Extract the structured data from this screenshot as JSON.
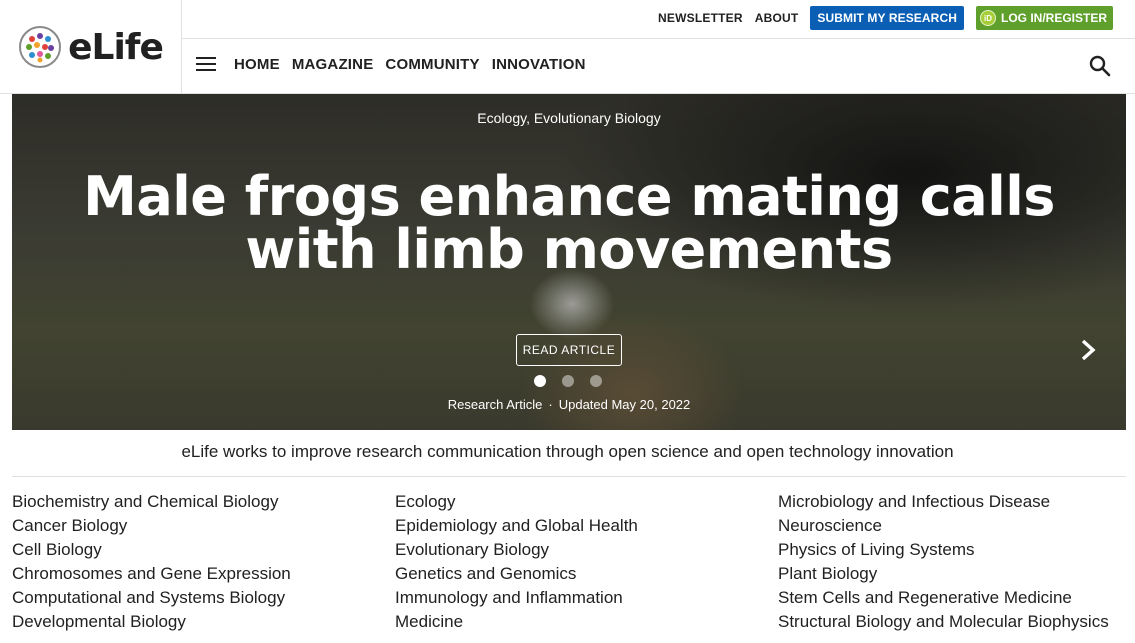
{
  "brand": {
    "name": "eLife"
  },
  "top_links": {
    "newsletter": "NEWSLETTER",
    "about": "ABOUT",
    "submit": "SUBMIT MY RESEARCH",
    "login": "LOG IN/REGISTER",
    "orcid_badge": "iD"
  },
  "nav": {
    "items": [
      {
        "label": "HOME"
      },
      {
        "label": "MAGAZINE"
      },
      {
        "label": "COMMUNITY"
      },
      {
        "label": "INNOVATION"
      }
    ]
  },
  "hero": {
    "subjects": "Ecology, Evolutionary Biology",
    "title": "Male frogs enhance mating calls with limb movements",
    "cta": "READ ARTICLE",
    "article_type": "Research Article",
    "separator": "·",
    "updated": "Updated May 20, 2022",
    "slides_total": 3,
    "active_slide": 1
  },
  "tagline": "eLife works to improve research communication through open science and open technology innovation",
  "subjects": {
    "col1": [
      "Biochemistry and Chemical Biology",
      "Cancer Biology",
      "Cell Biology",
      "Chromosomes and Gene Expression",
      "Computational and Systems Biology",
      "Developmental Biology"
    ],
    "col2": [
      "Ecology",
      "Epidemiology and Global Health",
      "Evolutionary Biology",
      "Genetics and Genomics",
      "Immunology and Inflammation",
      "Medicine"
    ],
    "col3": [
      "Microbiology and Infectious Disease",
      "Neuroscience",
      "Physics of Living Systems",
      "Plant Biology",
      "Stem Cells and Regenerative Medicine",
      "Structural Biology and Molecular Biophysics"
    ]
  },
  "colors": {
    "submit_button": "#0a5fb5",
    "login_button": "#5fa02d",
    "text": "#212121"
  },
  "icons": {
    "menu": "hamburger-icon",
    "search": "search-icon",
    "next": "chevron-right-icon",
    "orcid": "orcid-icon"
  }
}
